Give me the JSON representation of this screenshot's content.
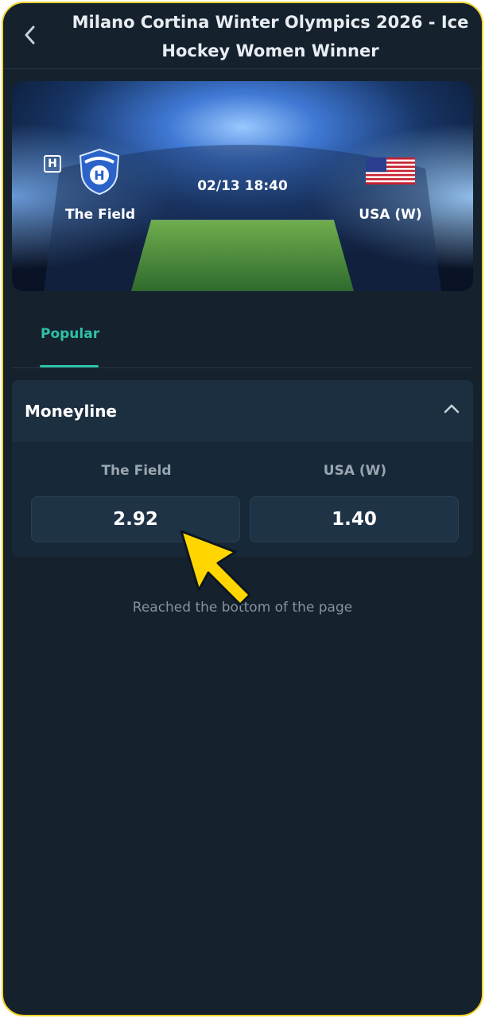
{
  "header": {
    "title": "Milano Cortina Winter Olympics 2026 - Ice Hockey Women Winner",
    "back_icon": "chevron-left-icon"
  },
  "match": {
    "home_team": "The Field",
    "home_badge": "H",
    "away_team": "USA (W)",
    "datetime": "02/13 18:40"
  },
  "tabs": [
    {
      "label": "Popular",
      "active": true
    }
  ],
  "market": {
    "title": "Moneyline",
    "collapse_icon": "chevron-up-icon",
    "outcomes": [
      {
        "label": "The Field",
        "odds": "2.92"
      },
      {
        "label": "USA (W)",
        "odds": "1.40"
      }
    ]
  },
  "footer": {
    "end_text": "Reached the bottom of the page"
  },
  "colors": {
    "background": "#15222e",
    "accent": "#2fc1a6",
    "frame": "#f2d22a",
    "cursor": "#ffd600"
  }
}
